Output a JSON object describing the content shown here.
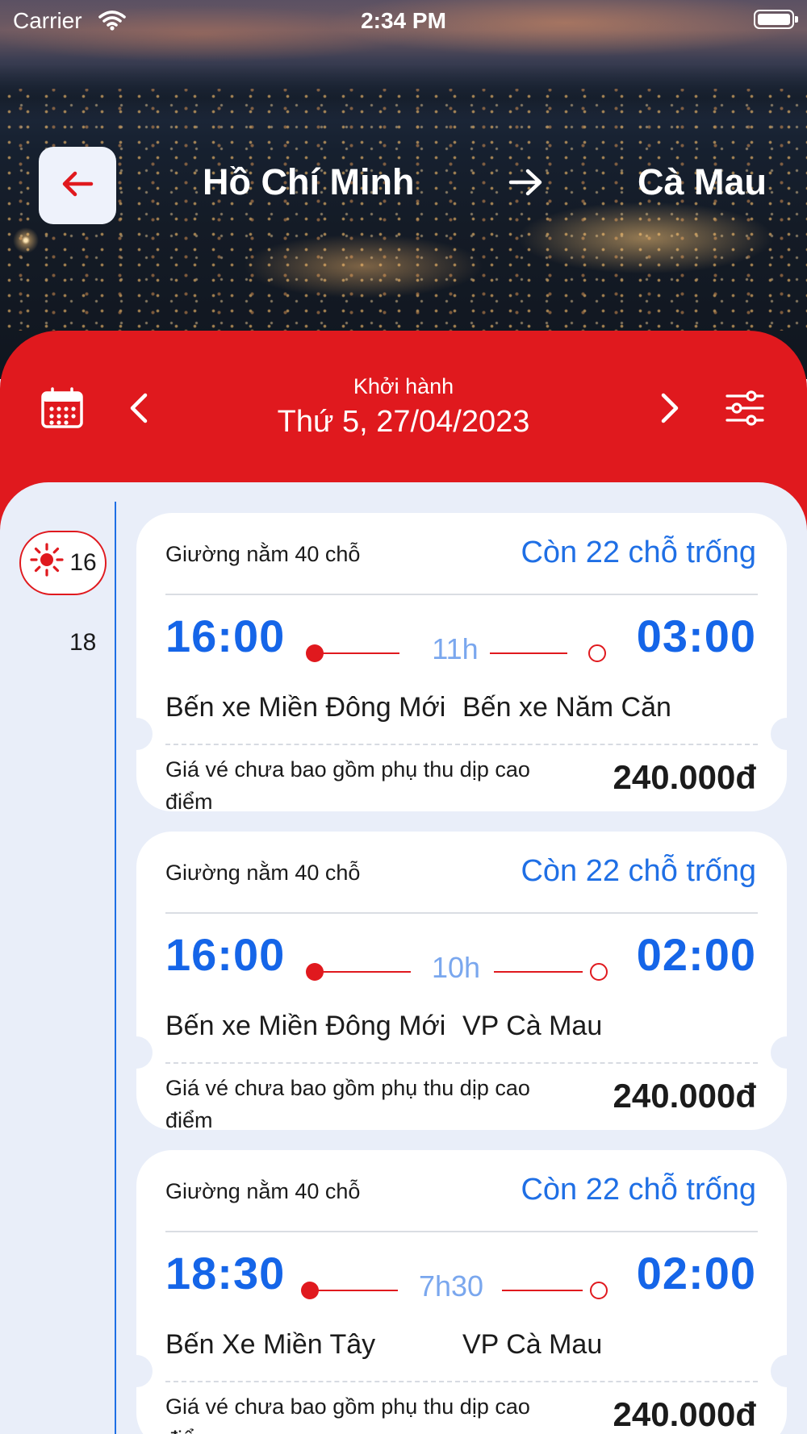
{
  "status_bar": {
    "carrier": "Carrier",
    "time": "2:34 PM"
  },
  "route": {
    "from": "Hồ Chí Minh",
    "to": "Cà Mau"
  },
  "date_bar": {
    "label": "Khởi hành",
    "date": "Thứ 5, 27/04/2023"
  },
  "day_list": {
    "selected_day": "16",
    "next_day": "18"
  },
  "trips": [
    {
      "vehicle_type": "Giường nằm 40 chỗ",
      "seats": "Còn 22 chỗ trống",
      "depart_time": "16:00",
      "duration": "11h",
      "arrive_time": "03:00",
      "from_station": "Bến xe Miền Đông Mới",
      "to_station": "Bến xe Năm Căn",
      "note": "Giá vé chưa bao gồm phụ thu dịp cao điểm",
      "price": "240.000đ"
    },
    {
      "vehicle_type": "Giường nằm 40 chỗ",
      "seats": "Còn 22 chỗ trống",
      "depart_time": "16:00",
      "duration": "10h",
      "arrive_time": "02:00",
      "from_station": "Bến xe Miền Đông Mới",
      "to_station": "VP Cà Mau",
      "note": "Giá vé chưa bao gồm phụ thu dịp cao điểm",
      "price": "240.000đ"
    },
    {
      "vehicle_type": "Giường nằm 40 chỗ",
      "seats": "Còn 22 chỗ trống",
      "depart_time": "18:30",
      "duration": "7h30",
      "arrive_time": "02:00",
      "from_station": "Bến Xe Miền Tây",
      "to_station": "VP Cà Mau",
      "note": "Giá vé chưa bao gồm phụ thu dịp cao điểm",
      "price": "240.000đ"
    }
  ],
  "colors": {
    "brand_red": "#e0191e",
    "accent_blue": "#1565e8",
    "background": "#e9eef9"
  },
  "icons": {
    "back": "arrow-left-icon",
    "route": "arrow-right-icon",
    "calendar": "calendar-icon",
    "prev": "chevron-left-icon",
    "next": "chevron-right-icon",
    "filter": "sliders-icon",
    "day": "sun-icon"
  }
}
